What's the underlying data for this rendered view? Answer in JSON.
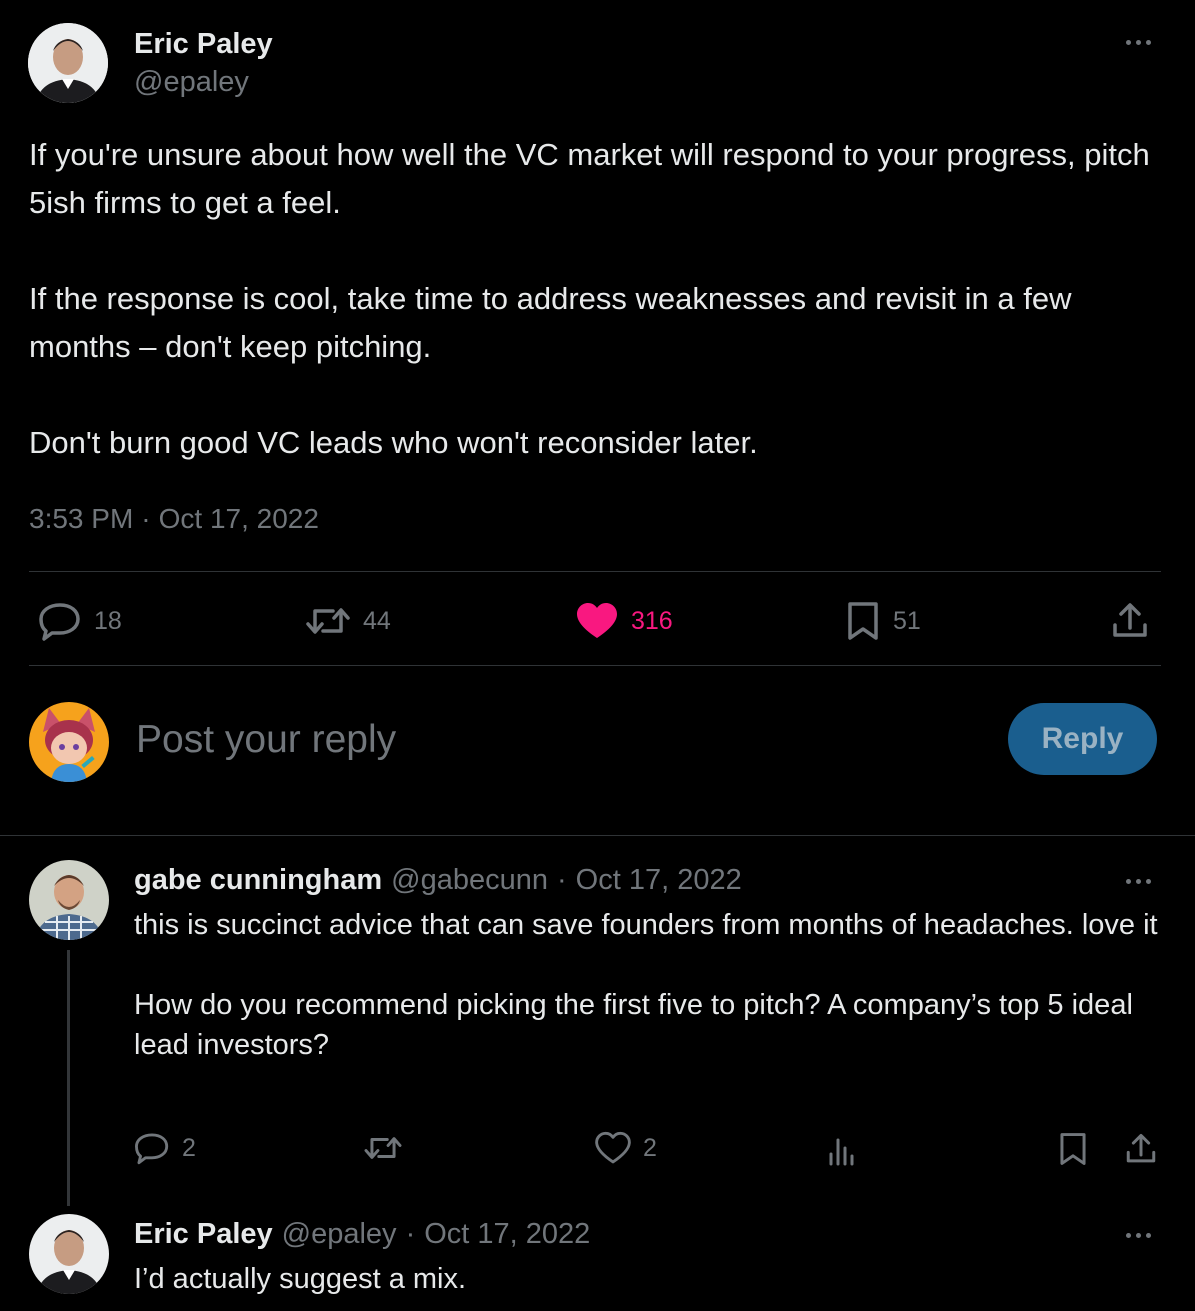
{
  "tweet": {
    "author_name": "Eric Paley",
    "author_handle": "@epaley",
    "text": "If you're unsure about how well the VC market will respond to your progress, pitch 5ish firms to get a feel.\n\nIf the response is cool, take time to address weaknesses and revisit in a few months – don't keep pitching.\n\nDon't burn good VC leads who won't reconsider later.",
    "time": "3:53 PM",
    "separator": "·",
    "date": "Oct 17, 2022",
    "stats": {
      "replies": "18",
      "reposts": "44",
      "likes": "316",
      "bookmarks": "51"
    }
  },
  "composer": {
    "placeholder": "Post your reply",
    "button_label": "Reply"
  },
  "replies": [
    {
      "author_name": "gabe cunningham",
      "author_handle": "@gabecunn",
      "separator": "·",
      "date": "Oct 17, 2022",
      "text": "this is succinct advice that can save founders from months of headaches. love it\n\nHow do you recommend picking the first five to pitch? A company’s top 5 ideal lead investors?",
      "stats": {
        "replies": "2",
        "likes": "2"
      }
    },
    {
      "author_name": "Eric Paley",
      "author_handle": "@epaley",
      "separator": "·",
      "date": "Oct 17, 2022",
      "text": "I’d actually suggest a mix."
    }
  ],
  "colors": {
    "like_active": "#f91880",
    "reply_button_bg": "#1a5e8e",
    "muted_text": "#71767b",
    "divider": "#2f3336"
  },
  "icons": [
    "more-icon",
    "reply-icon",
    "repost-icon",
    "like-icon",
    "bookmark-icon",
    "share-icon",
    "views-icon"
  ]
}
